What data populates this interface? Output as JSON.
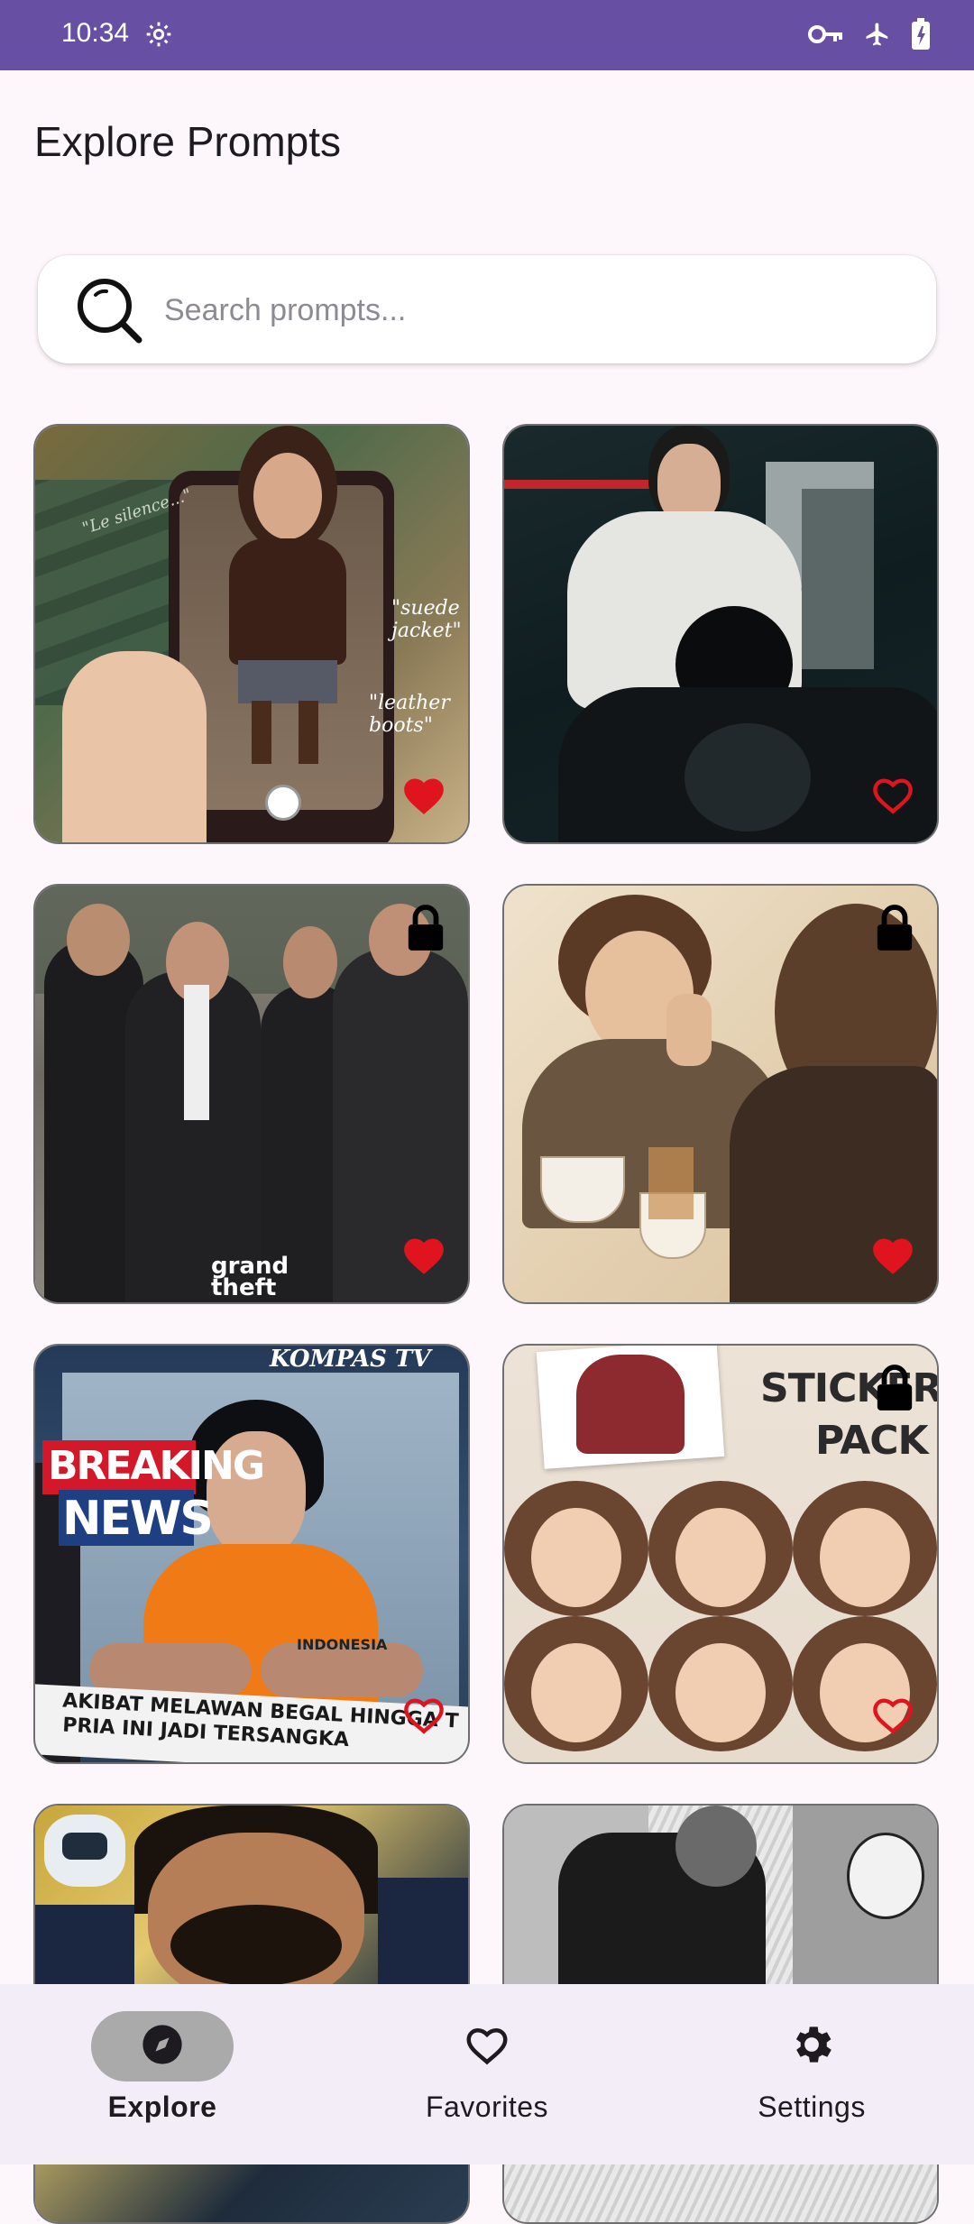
{
  "status_bar": {
    "time": "10:34",
    "icons": [
      "gear-icon",
      "key-icon",
      "airplane-icon",
      "battery-icon"
    ],
    "background": "#6750a4"
  },
  "page": {
    "title": "Explore Prompts"
  },
  "search": {
    "placeholder": "Search prompts..."
  },
  "cards": [
    {
      "favorited": true,
      "locked": false,
      "overlay": [
        "\"Le silence...\"",
        "\"suede jacket\"",
        "\"leather boots\""
      ]
    },
    {
      "favorited": false,
      "locked": false,
      "overlay": []
    },
    {
      "favorited": true,
      "locked": true,
      "overlay": [
        "grand theft"
      ]
    },
    {
      "favorited": true,
      "locked": true,
      "overlay": []
    },
    {
      "favorited": false,
      "locked": false,
      "overlay": [
        "KOMPAS TV",
        "BREAKING",
        "NEWS",
        "INDONESIA",
        "AKIBAT MELAWAN BEGAL HINGGA TEWAS",
        "PRIA INI JADI TERSANGKA"
      ]
    },
    {
      "favorited": false,
      "locked": true,
      "overlay": [
        "STICKER",
        "PACK"
      ]
    },
    {
      "favorited": false,
      "locked": false,
      "overlay": []
    },
    {
      "favorited": false,
      "locked": false,
      "overlay": []
    }
  ],
  "bottom_nav": {
    "items": [
      {
        "label": "Explore",
        "icon": "compass-icon",
        "active": true
      },
      {
        "label": "Favorites",
        "icon": "heart-outline-icon",
        "active": false
      },
      {
        "label": "Settings",
        "icon": "gear-icon",
        "active": false
      }
    ]
  },
  "colors": {
    "accent": "#6750a4",
    "heart": "#e0141e",
    "background": "#fdf7fc",
    "nav_background": "#f3edf7"
  }
}
